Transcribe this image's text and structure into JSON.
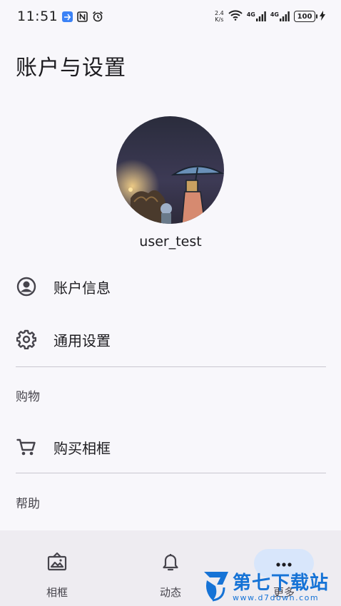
{
  "status_bar": {
    "time": "11:51",
    "net_speed_value": "2.4",
    "net_speed_unit": "K/s",
    "signal_1_label": "4G",
    "signal_2_label": "4G",
    "battery": "100"
  },
  "page": {
    "title": "账户与设置",
    "username": "user_test"
  },
  "menu": {
    "account_info": "账户信息",
    "general_settings": "通用设置",
    "shopping_section": "购物",
    "buy_frame": "购买相框",
    "help_section": "帮助"
  },
  "bottom_nav": {
    "items": [
      {
        "label": "相框",
        "icon": "photo-frame-icon"
      },
      {
        "label": "动态",
        "icon": "bell-icon"
      },
      {
        "label": "更多",
        "icon": "more-dots-icon",
        "active": true
      }
    ]
  },
  "watermark": {
    "name": "第七下载站",
    "url": "www.d7down.com"
  },
  "colors": {
    "background": "#f8f7fb",
    "nav_background": "#eeecf1",
    "active_pill": "#d8e6fb",
    "watermark_blue": "#1673d6"
  }
}
